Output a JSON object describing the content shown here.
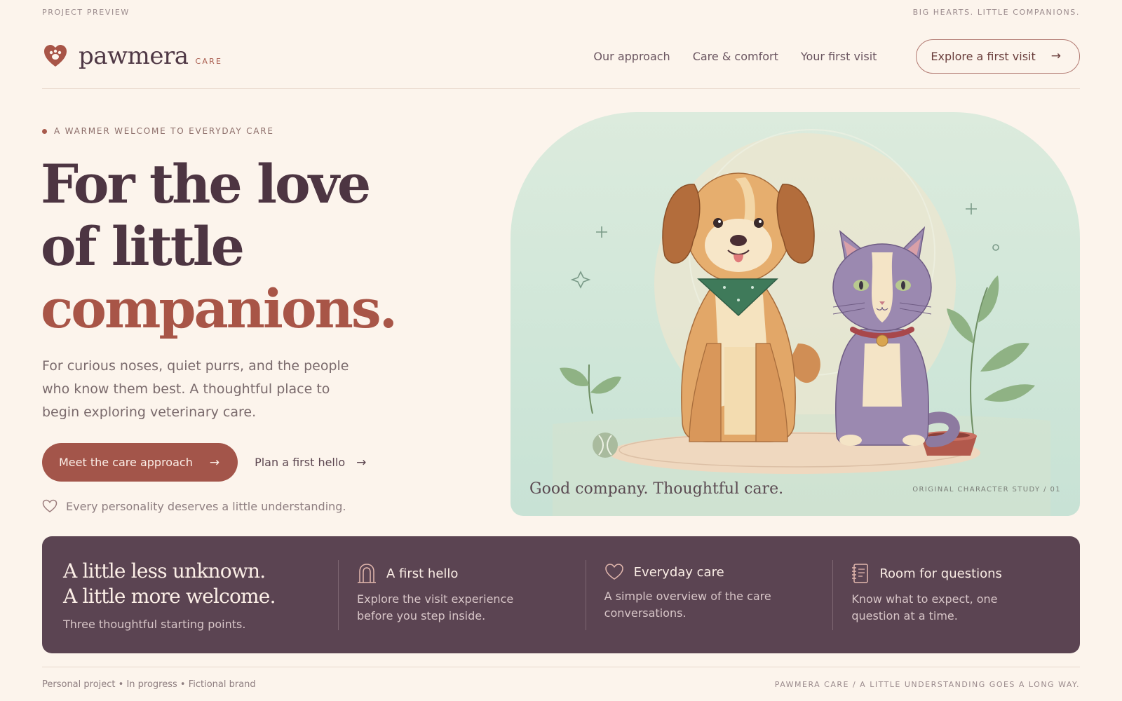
{
  "topbar": {
    "left": "PROJECT PREVIEW",
    "right": "BIG HEARTS. LITTLE COMPANIONS."
  },
  "brand": {
    "name": "pawmera",
    "suffix": "CARE",
    "icon": "paw-heart-icon"
  },
  "nav": {
    "items": [
      {
        "label": "Our approach"
      },
      {
        "label": "Care & comfort"
      },
      {
        "label": "Your first visit"
      }
    ],
    "cta": "Explore a first visit"
  },
  "hero": {
    "eyebrow": "A WARMER WELCOME TO EVERYDAY CARE",
    "headline_line1": "For the love",
    "headline_line2": "of little",
    "headline_accent": "companions.",
    "lede": "For curious noses, quiet purrs, and the people who know them best. A thoughtful place to begin exploring veterinary care.",
    "primary_cta": "Meet the care approach",
    "secondary_cta": "Plan a first hello",
    "tagline": "Every personality deserves a little understanding."
  },
  "illustration": {
    "caption": "Good company. Thoughtful care.",
    "credit": "ORIGINAL CHARACTER STUDY / 01"
  },
  "band": {
    "title_line1": "A little less unknown.",
    "title_line2": "A little more welcome.",
    "subtitle": "Three thoughtful starting points.",
    "items": [
      {
        "icon": "door-icon",
        "title": "A first hello",
        "text": "Explore the visit experience before you step inside."
      },
      {
        "icon": "heart-icon",
        "title": "Everyday care",
        "text": "A simple overview of the care conversations."
      },
      {
        "icon": "notebook-icon",
        "title": "Room for questions",
        "text": "Know what to expect, one question at a time."
      }
    ]
  },
  "footer": {
    "left": "Personal project • In progress • Fictional brand",
    "right": "PAWMERA CARE / A LITTLE UNDERSTANDING GOES A LONG WAY."
  },
  "colors": {
    "background": "#fcf4ec",
    "accent": "#a3554a",
    "plum": "#5b4452",
    "mint": "#cfe6d8"
  }
}
